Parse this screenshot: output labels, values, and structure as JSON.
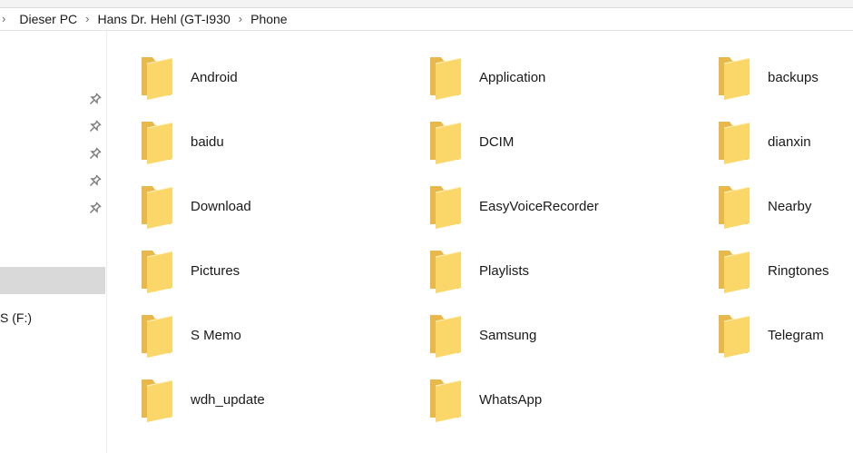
{
  "breadcrumb": {
    "items": [
      "Dieser PC",
      "Hans Dr. Hehl (GT-I930",
      "Phone"
    ]
  },
  "nav_pane": {
    "drive_label": "S (F:)"
  },
  "folders": [
    "Android",
    "Application",
    "backups",
    "baidu",
    "DCIM",
    "dianxin",
    "Download",
    "EasyVoiceRecorder",
    "Nearby",
    "Pictures",
    "Playlists",
    "Ringtones",
    "S Memo",
    "Samsung",
    "Telegram",
    "wdh_update",
    "WhatsApp"
  ],
  "colors": {
    "folder_back": "#e8b94a",
    "folder_front": "#fbd76a",
    "selection": "#d9d9d9"
  },
  "icons": [
    "chevron-right-icon",
    "pin-icon",
    "folder-icon"
  ]
}
